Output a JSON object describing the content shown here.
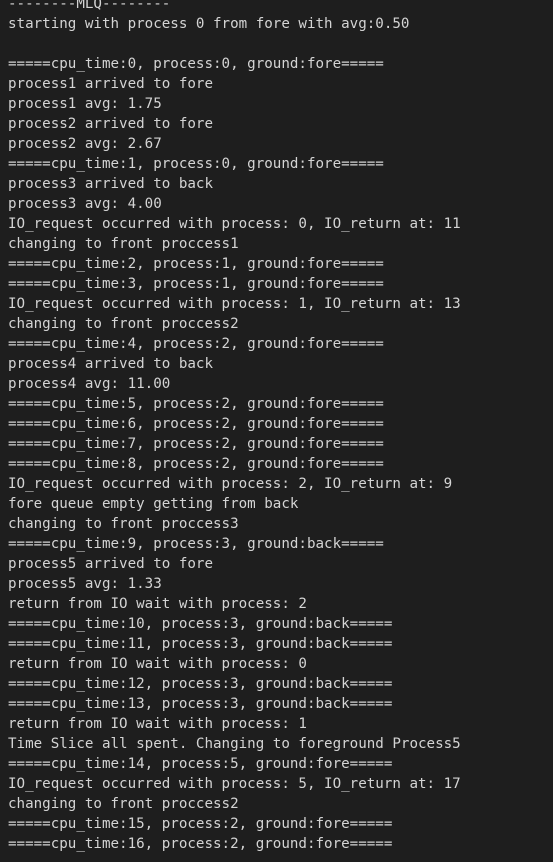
{
  "terminal": {
    "lines": [
      "--------MLQ--------",
      "starting with process 0 from fore with avg:0.50",
      "",
      "=====cpu_time:0, process:0, ground:fore=====",
      "process1 arrived to fore",
      "process1 avg: 1.75",
      "process2 arrived to fore",
      "process2 avg: 2.67",
      "=====cpu_time:1, process:0, ground:fore=====",
      "process3 arrived to back",
      "process3 avg: 4.00",
      "IO_request occurred with process: 0, IO_return at: 11",
      "changing to front proccess1",
      "=====cpu_time:2, process:1, ground:fore=====",
      "=====cpu_time:3, process:1, ground:fore=====",
      "IO_request occurred with process: 1, IO_return at: 13",
      "changing to front proccess2",
      "=====cpu_time:4, process:2, ground:fore=====",
      "process4 arrived to back",
      "process4 avg: 11.00",
      "=====cpu_time:5, process:2, ground:fore=====",
      "=====cpu_time:6, process:2, ground:fore=====",
      "=====cpu_time:7, process:2, ground:fore=====",
      "=====cpu_time:8, process:2, ground:fore=====",
      "IO_request occurred with process: 2, IO_return at: 9",
      "fore queue empty getting from back",
      "changing to front proccess3",
      "=====cpu_time:9, process:3, ground:back=====",
      "process5 arrived to fore",
      "process5 avg: 1.33",
      "return from IO wait with process: 2",
      "=====cpu_time:10, process:3, ground:back=====",
      "=====cpu_time:11, process:3, ground:back=====",
      "return from IO wait with process: 0",
      "=====cpu_time:12, process:3, ground:back=====",
      "=====cpu_time:13, process:3, ground:back=====",
      "return from IO wait with process: 1",
      "Time Slice all spent. Changing to foreground Process5",
      "=====cpu_time:14, process:5, ground:fore=====",
      "IO_request occurred with process: 5, IO_return at: 17",
      "changing to front proccess2",
      "=====cpu_time:15, process:2, ground:fore=====",
      "=====cpu_time:16, process:2, ground:fore====="
    ]
  }
}
